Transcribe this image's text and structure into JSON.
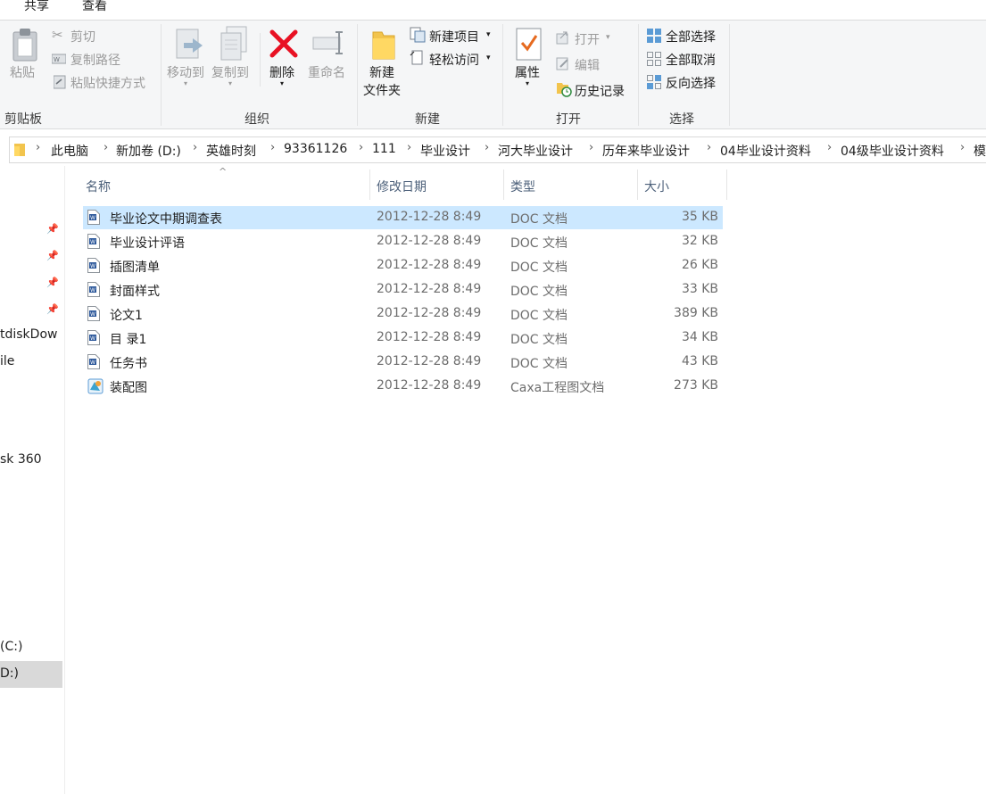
{
  "tabs": [
    "共享",
    "查看"
  ],
  "ribbon": {
    "clipboard": {
      "paste": "粘贴",
      "cut": "剪切",
      "copy_path": "复制路径",
      "paste_shortcut": "粘贴快捷方式",
      "label": "剪贴板"
    },
    "organize": {
      "move_to": "移动到",
      "copy_to": "复制到",
      "delete": "删除",
      "rename": "重命名",
      "label": "组织"
    },
    "new": {
      "new_folder_line1": "新建",
      "new_folder_line2": "文件夹",
      "new_item": "新建项目",
      "easy_access": "轻松访问",
      "label": "新建"
    },
    "open": {
      "properties": "属性",
      "open": "打开",
      "edit": "编辑",
      "history": "历史记录",
      "label": "打开"
    },
    "select": {
      "select_all": "全部选择",
      "select_none": "全部取消",
      "invert": "反向选择",
      "label": "选择"
    }
  },
  "breadcrumb": [
    "此电脑",
    "新加卷 (D:)",
    "英雄时刻",
    "93361126",
    "111",
    "毕业设计",
    "河大毕业设计",
    "历年来毕业设计",
    "04毕业设计资料",
    "04级毕业设计资料",
    "模"
  ],
  "nav": {
    "items": [
      "tdiskDow",
      "ile",
      "sk 360",
      " (C:)",
      "D:)"
    ]
  },
  "columns": {
    "name": "名称",
    "date": "修改日期",
    "type": "类型",
    "size": "大小"
  },
  "files": [
    {
      "name": "毕业论文中期调查表",
      "date": "2012-12-28 8:49",
      "type": "DOC 文档",
      "size": "35 KB",
      "icon": "word-doc-icon"
    },
    {
      "name": "毕业设计评语",
      "date": "2012-12-28 8:49",
      "type": "DOC 文档",
      "size": "32 KB",
      "icon": "word-doc-icon"
    },
    {
      "name": "插图清单",
      "date": "2012-12-28 8:49",
      "type": "DOC 文档",
      "size": "26 KB",
      "icon": "word-doc-icon"
    },
    {
      "name": "封面样式",
      "date": "2012-12-28 8:49",
      "type": "DOC 文档",
      "size": "33 KB",
      "icon": "word-doc-icon"
    },
    {
      "name": "论文1",
      "date": "2012-12-28 8:49",
      "type": "DOC 文档",
      "size": "389 KB",
      "icon": "word-doc-icon"
    },
    {
      "name": "目 录1",
      "date": "2012-12-28 8:49",
      "type": "DOC 文档",
      "size": "34 KB",
      "icon": "word-doc-icon"
    },
    {
      "name": "任务书",
      "date": "2012-12-28 8:49",
      "type": "DOC 文档",
      "size": "43 KB",
      "icon": "word-doc-icon"
    },
    {
      "name": "装配图",
      "date": "2012-12-28 8:49",
      "type": "Caxa工程图文档",
      "size": "273 KB",
      "icon": "caxa-drawing-icon"
    }
  ],
  "colors": {
    "selection": "#cce8ff",
    "header_text": "#4c607a",
    "delete_red": "#e81123"
  }
}
